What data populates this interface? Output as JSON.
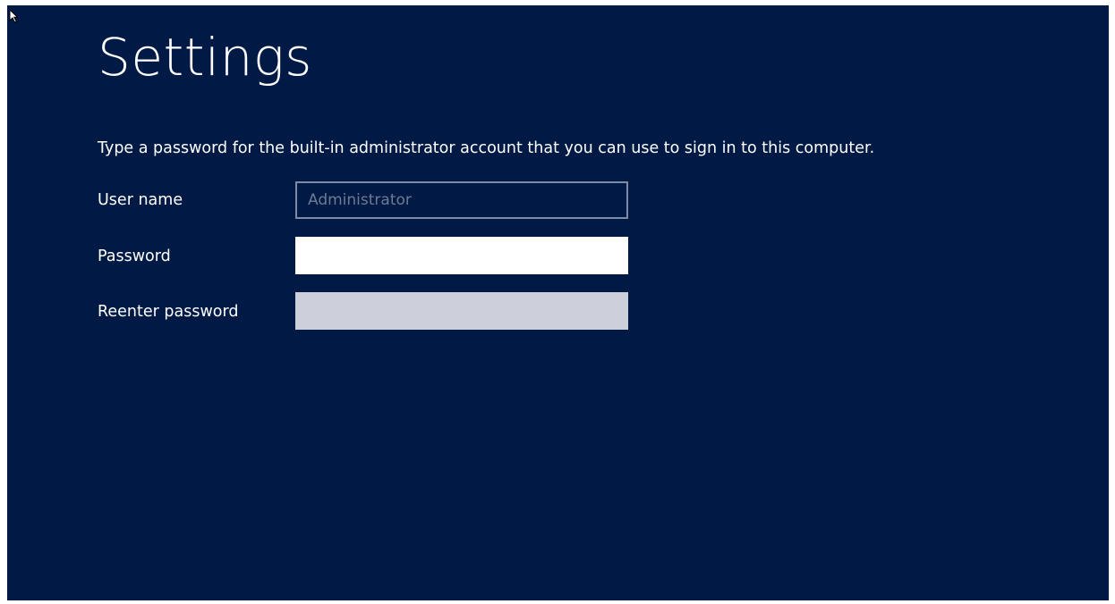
{
  "page": {
    "title": "Settings",
    "instruction": "Type a password for the built-in administrator account that you can use to sign in to this computer."
  },
  "form": {
    "username": {
      "label": "User name",
      "value": "Administrator",
      "disabled": true
    },
    "password": {
      "label": "Password",
      "value": ""
    },
    "reenter_password": {
      "label": "Reenter password",
      "value": ""
    }
  },
  "colors": {
    "background": "#001a45",
    "text": "#ffffff",
    "username_field_border": "#7d8ba5",
    "username_field_text": "#6e7b94",
    "password_field_bg": "#ffffff",
    "reenter_field_bg": "#cdd0db"
  },
  "icons": {
    "cursor": "mouse-pointer-icon"
  }
}
